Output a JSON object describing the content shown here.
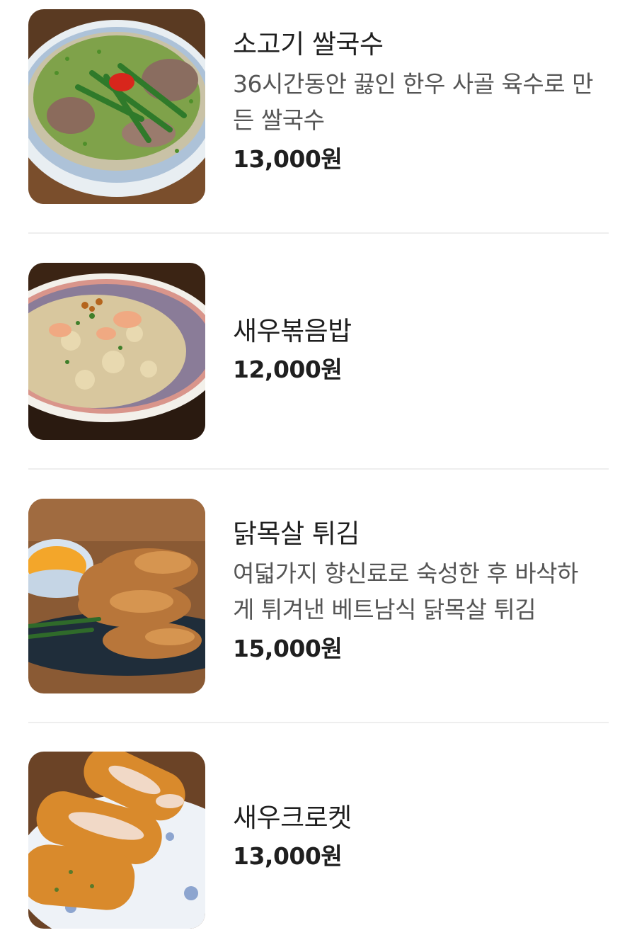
{
  "menu_items": [
    {
      "name": "소고기 쌀국수",
      "description": "36시간동안 끓인 한우 사골 육수로 만 든 쌀국수",
      "description_lines": [
        "36시간동안 끓인 한우 사골 육수로 만",
        "든 쌀국수"
      ],
      "price": "13,000원",
      "image": "beef-pho-photo"
    },
    {
      "name": "새우볶음밥",
      "price": "12,000원",
      "image": "shrimp-fried-rice-photo"
    },
    {
      "name": "닭목살 튀김",
      "description": "여덟가지 향신료로 숙성한 후 바삭하 게 튀겨낸 베트남식 닭목살 튀김",
      "description_lines": [
        "여덟가지 향신료로 숙성한 후 바삭하",
        "게 튀겨낸 베트남식 닭목살 튀김"
      ],
      "price": "15,000원",
      "image": "fried-chicken-neck-photo"
    },
    {
      "name": "새우크로켓",
      "price": "13,000원",
      "image": "shrimp-croquette-photo"
    }
  ],
  "colors": {
    "text_primary": "#1f1f1f",
    "text_secondary": "#555555",
    "divider": "#eeeeee"
  }
}
